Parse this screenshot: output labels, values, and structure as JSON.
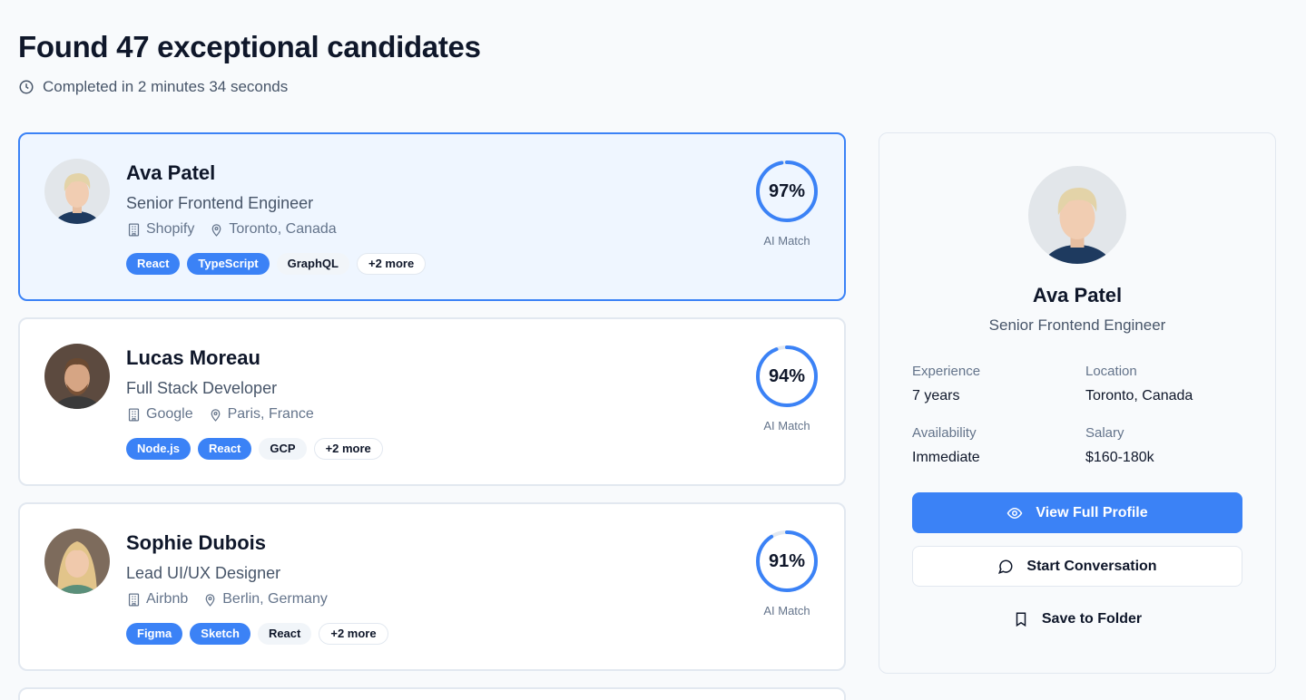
{
  "header": {
    "title": "Found 47 exceptional candidates",
    "completed": "Completed in 2 minutes 34 seconds"
  },
  "colors": {
    "accent": "#3b82f6",
    "selected_bg": "#eff6ff"
  },
  "candidates": [
    {
      "name": "Ava Patel",
      "role": "Senior Frontend Engineer",
      "company": "Shopify",
      "location": "Toronto, Canada",
      "tags": [
        "React",
        "TypeScript",
        "GraphQL"
      ],
      "more": "+2 more",
      "match": "97%",
      "match_value": 97,
      "match_label": "AI Match"
    },
    {
      "name": "Lucas Moreau",
      "role": "Full Stack Developer",
      "company": "Google",
      "location": "Paris, France",
      "tags": [
        "Node.js",
        "React",
        "GCP"
      ],
      "more": "+2 more",
      "match": "94%",
      "match_value": 94,
      "match_label": "AI Match"
    },
    {
      "name": "Sophie Dubois",
      "role": "Lead UI/UX Designer",
      "company": "Airbnb",
      "location": "Berlin, Germany",
      "tags": [
        "Figma",
        "Sketch",
        "React"
      ],
      "more": "+2 more",
      "match": "91%",
      "match_value": 91,
      "match_label": "AI Match"
    }
  ],
  "detail": {
    "name": "Ava Patel",
    "role": "Senior Frontend Engineer",
    "experience_label": "Experience",
    "experience": "7 years",
    "location_label": "Location",
    "location": "Toronto, Canada",
    "availability_label": "Availability",
    "availability": "Immediate",
    "salary_label": "Salary",
    "salary": "$160-180k",
    "view_profile": "View Full Profile",
    "start_conversation": "Start Conversation",
    "save_to_folder": "Save to Folder"
  }
}
